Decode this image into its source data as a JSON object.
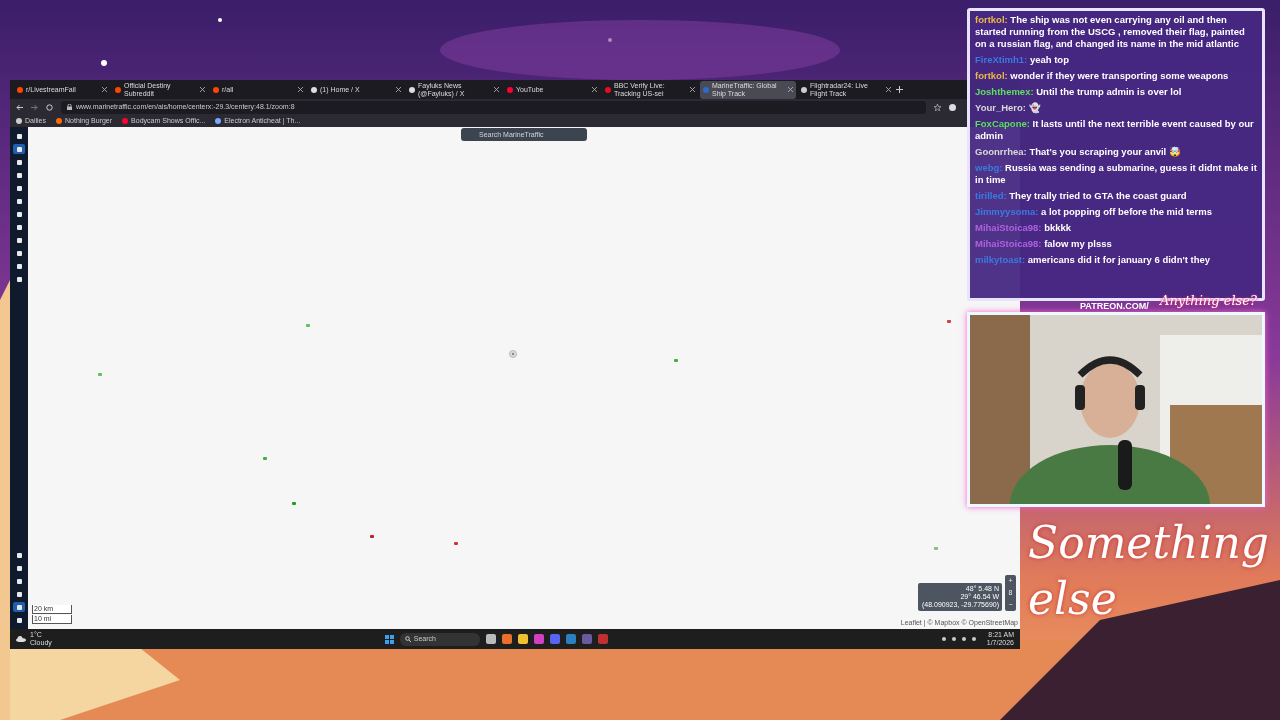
{
  "browser": {
    "tabs": [
      {
        "label": "r/LivestreamFail",
        "selected": false,
        "color": "#ff4500"
      },
      {
        "label": "Official Destiny Subreddit",
        "selected": false,
        "color": "#ff4500"
      },
      {
        "label": "r/all",
        "selected": false,
        "color": "#ff4500"
      },
      {
        "label": "(1) Home / X",
        "selected": false,
        "color": "#dddddd"
      },
      {
        "label": "Fayluks News (@Fayluks) / X",
        "selected": false,
        "color": "#dddddd"
      },
      {
        "label": "YouTube",
        "selected": false,
        "color": "#ff0033"
      },
      {
        "label": "BBC Verify Live: Tracking US-sei",
        "selected": false,
        "color": "#e01020"
      },
      {
        "label": "MarineTraffic: Global Ship Track",
        "selected": true,
        "color": "#2a6ad0"
      },
      {
        "label": "Flightradar24: Live Flight Track",
        "selected": false,
        "color": "#cccccc"
      }
    ],
    "address": "www.marinetraffic.com/en/ais/home/centerx:-29.3/centery:48.1/zoom:8",
    "bookmarks": [
      {
        "label": "Dailies",
        "color": "#cccccc"
      },
      {
        "label": "Nothing Burger",
        "color": "#ff6a00"
      },
      {
        "label": "Bodycam Shows Offic...",
        "color": "#ff0033"
      },
      {
        "label": "Electron Anticheat | Th...",
        "color": "#7aa7ff"
      }
    ]
  },
  "map": {
    "search": {
      "placeholder": "Search MarineTraffic"
    },
    "rail_top": [
      {
        "selected": false
      },
      {
        "selected": true
      },
      {
        "selected": false
      },
      {
        "selected": false
      },
      {
        "selected": false
      },
      {
        "selected": false
      },
      {
        "selected": false
      },
      {
        "selected": false
      },
      {
        "selected": false
      },
      {
        "selected": false
      },
      {
        "selected": false
      },
      {
        "selected": false
      }
    ],
    "rail_bottom": [
      {
        "selected": false
      },
      {
        "selected": false
      },
      {
        "selected": false
      },
      {
        "selected": false
      },
      {
        "selected": true
      },
      {
        "selected": false
      }
    ],
    "ships": [
      {
        "color": "#60c060"
      },
      {
        "color": "#60c060"
      },
      {
        "color": "#40b040"
      },
      {
        "color": "#40b040"
      },
      {
        "color": "#20a020"
      },
      {
        "color": "#d04040"
      },
      {
        "color": "#c02020"
      },
      {
        "color": "#d03030"
      },
      {
        "color": "#80c080"
      }
    ],
    "coords": [
      "48° 5.48 N",
      "29° 46.54 W",
      "(48.090923, -29.775690)"
    ],
    "zoom": [
      "+",
      "8",
      "−"
    ],
    "scale": [
      "20 km",
      "10 mi"
    ],
    "attribution": "Leaflet | © Mapbox © OpenStreetMap"
  },
  "taskbar": {
    "weather": {
      "temp": "1°C",
      "sky": "Cloudy"
    },
    "search": "Search",
    "time": "8:21 AM",
    "date": "1/7/2026"
  },
  "chat": [
    {
      "user": "fortkol:",
      "color": "#e8b84a",
      "text": "The ship was not even carrying any oil and then started running from the USCG , removed their flag, painted on a russian flag, and changed its name in the mid atlantic"
    },
    {
      "user": "FireXtimh1:",
      "color": "#3a7ae0",
      "text": "yeah top"
    },
    {
      "user": "fortkol:",
      "color": "#e8b84a",
      "text": "wonder if they were transporting some weapons"
    },
    {
      "user": "Joshthemex:",
      "color": "#5ce05c",
      "text": "Until the trump admin is over lol"
    },
    {
      "user": "Your_Hero:",
      "color": "#d8d8d8",
      "text": "👻"
    },
    {
      "user": "FoxCapone:",
      "color": "#5ce05c",
      "text": "It lasts until the next terrible event caused by our admin"
    },
    {
      "user": "Goonrrhea:",
      "color": "#d8d8d8",
      "text": "That's you scraping your anvil 🤯"
    },
    {
      "user": "webg:",
      "color": "#3a7ae0",
      "text": "Russia was sending a submarine, guess it didnt make it in time"
    },
    {
      "user": "tirilled:",
      "color": "#3a7ae0",
      "text": "They trally tried to GTA the coast guard"
    },
    {
      "user": "Jimmyysoma:",
      "color": "#3a7ae0",
      "text": "a lot popping off before the mid terms"
    },
    {
      "user": "MihaiStoica98:",
      "color": "#b060e0",
      "text": "bkkkk"
    },
    {
      "user": "MihaiStoica98:",
      "color": "#b060e0",
      "text": "falow my plsss"
    },
    {
      "user": "milkytoast:",
      "color": "#3a7ae0",
      "text": "americans did it for january 6 didn't they"
    }
  ],
  "overlay": {
    "patreon": "PATREON.COM/",
    "tagline": "Anything else?",
    "logo": "Something else"
  }
}
